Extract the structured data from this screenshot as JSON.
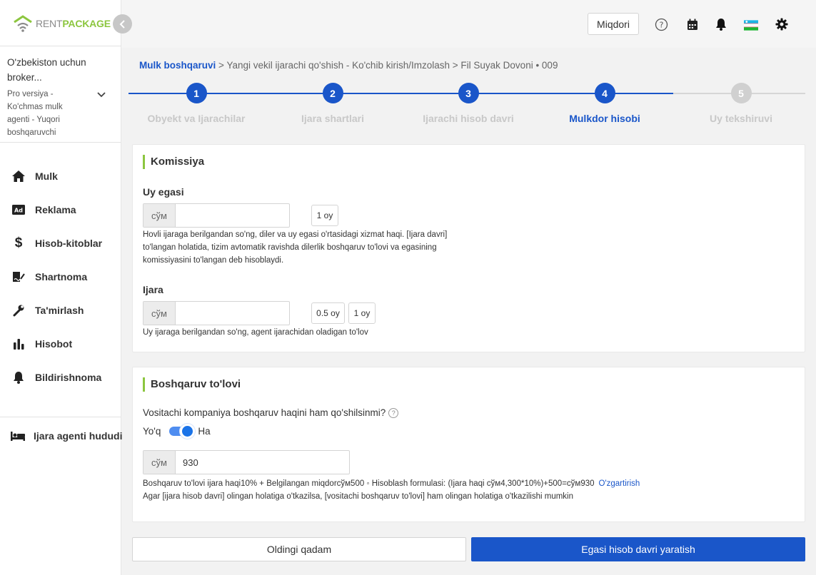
{
  "brand": {
    "part1": "RENT",
    "part2": "PACKAGE"
  },
  "org": {
    "name": "O'zbekiston uchun broker...",
    "role": "Pro versiya - Ko'chmas mulk agenti - Yuqori boshqaruvchi"
  },
  "nav": {
    "items": [
      {
        "label": "Mulk",
        "icon": "home-icon"
      },
      {
        "label": "Reklama",
        "icon": "ad-icon"
      },
      {
        "label": "Hisob-kitoblar",
        "icon": "dollar-icon"
      },
      {
        "label": "Shartnoma",
        "icon": "contract-icon"
      },
      {
        "label": "Ta'mirlash",
        "icon": "wrench-icon"
      },
      {
        "label": "Hisobot",
        "icon": "bar-chart-icon"
      },
      {
        "label": "Bildirishnoma",
        "icon": "bell-icon"
      }
    ],
    "agent_area": {
      "label": "Ijara agenti hududi",
      "icon": "bed-icon"
    }
  },
  "header": {
    "miqdori_label": "Miqdori"
  },
  "breadcrumb": {
    "root": "Mulk boshqaruvi",
    "sep": ">",
    "middle": "Yangi vekil ijarachi qo'shish - Ko'chib kirish/Imzolash",
    "last": "Fil Suyak Dovoni • 009"
  },
  "steps": [
    {
      "num": "1",
      "title": "Obyekt va Ijarachilar",
      "state": "done"
    },
    {
      "num": "2",
      "title": "Ijara shartlari",
      "state": "done"
    },
    {
      "num": "3",
      "title": "Ijarachi hisob davri",
      "state": "done"
    },
    {
      "num": "4",
      "title": "Mulkdor hisobi",
      "state": "current"
    },
    {
      "num": "5",
      "title": "Uy tekshiruvi",
      "state": "pending"
    }
  ],
  "commission": {
    "title": "Komissiya",
    "owner": {
      "label": "Uy egasi",
      "prefix": "сўм",
      "value": "",
      "pill": "1 oy",
      "help": "Hovli ijaraga berilgandan so'ng, diler va uy egasi o'rtasidagi xizmat haqi. [Ijara davri] to'langan holatida, tizim avtomatik ravishda dilerlik boshqaruv to'lovi va egasining komissiyasini to'langan deb hisoblaydi."
    },
    "rent": {
      "label": "Ijara",
      "prefix": "сўм",
      "value": "",
      "pill1": "0.5 oy",
      "pill2": "1 oy",
      "help": "Uy ijaraga berilgandan so'ng, agent ijarachidan oladigan to'lov"
    }
  },
  "management": {
    "title": "Boshqaruv to'lovi",
    "question": "Vositachi kompaniya boshqaruv haqini ham qo'shilsinmi?",
    "toggle_off": "Yo'q",
    "toggle_on": "Ha",
    "toggle_state": true,
    "prefix": "сўм",
    "value": "930",
    "formula": "Boshqaruv to'lovi ijara haqi10% + Belgilangan miqdorсўм500 ◦ Hisoblash formulasi: (Ijara haqi сўм4,300*10%)+500=сўм930",
    "edit_link": "O'zgartirish",
    "note": "Agar [ijara hisob davri] olingan holatiga o'tkazilsa, [vositachi boshqaruv to'lovi] ham olingan holatiga o'tkazilishi mumkin"
  },
  "footer": {
    "prev_label": "Oldingi qadam",
    "next_label": "Egasi hisob davri yaratish"
  },
  "colors": {
    "primary": "#1a56c9",
    "brand_green": "#8cc63f",
    "inactive": "#d0d0d0"
  }
}
